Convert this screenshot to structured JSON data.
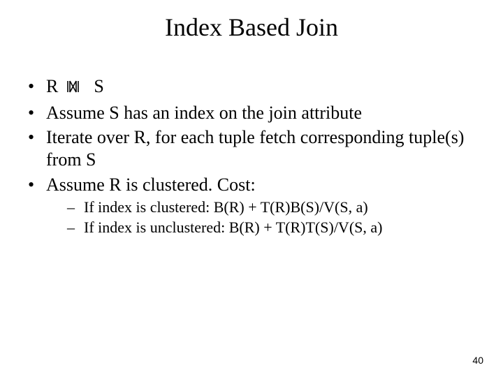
{
  "title": "Index Based Join",
  "bullets": {
    "b1_left": "R",
    "b1_right": "S",
    "b2": "Assume S has an index on the join attribute",
    "b3": "Iterate over R, for each tuple fetch corresponding tuple(s) from S",
    "b4": "Assume R is clustered. Cost:",
    "sub1": "If index is clustered:  B(R) + T(R)B(S)/V(S, a)",
    "sub2": "If index is unclustered: B(R) + T(R)T(S)/V(S, a)"
  },
  "page_number": "40",
  "icons": {
    "join_symbol": "natural-join-icon"
  }
}
